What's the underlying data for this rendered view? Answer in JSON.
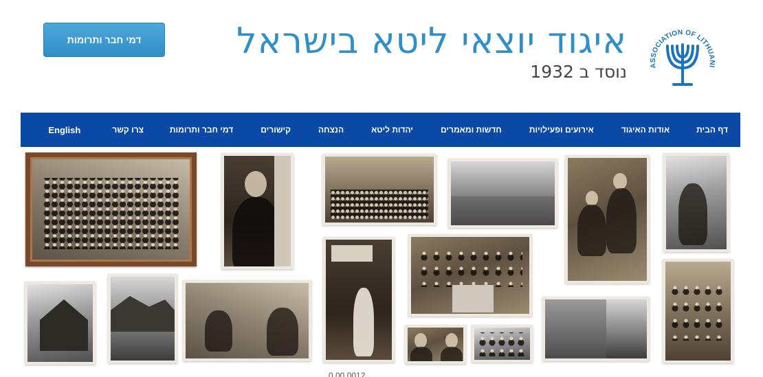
{
  "header": {
    "donate_button": "דמי חבר ותרומות",
    "title": "איגוד יוצאי ליטא בישראל",
    "subtitle": "נוסד ב 1932",
    "logo_text": "ASSOCIATION OF LITHUANIAN JEWS IN ISRAEL"
  },
  "nav": {
    "items": [
      "דף הבית",
      "אודות האיגוד",
      "אירועים ופעילויות",
      "חדשות ומאמרים",
      "יהדות ליטא",
      "הנצחה",
      "קישורים",
      "דמי חבר ותרומות",
      "צרו קשר",
      "English"
    ]
  },
  "colors": {
    "accent": "#2f8fc8",
    "nav_background": "#0a4aa6",
    "logo_blue": "#1e73be"
  },
  "photos": [
    "group-portrait-photo",
    "man-portrait-photo",
    "street-crowd-photo",
    "town-street-photo",
    "women-with-instruments-photo",
    "clergy-procession-photo",
    "wooden-house-photo",
    "village-houses-photo",
    "workshop-photo",
    "shop-girl-photo",
    "seated-group-photo",
    "children-group-photo",
    "shop-street-photo",
    "rabbi-portraits-photo",
    "soldiers-photo"
  ],
  "footer_date_fragment": "0.00.0012"
}
